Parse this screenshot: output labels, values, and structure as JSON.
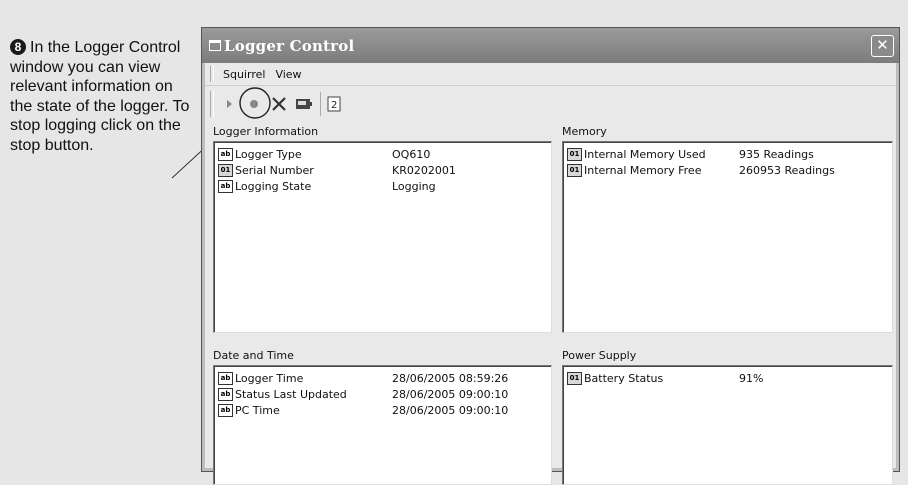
{
  "callout": {
    "step_number": "8",
    "text": "In the Logger Control window you can view relevant information on the state of the logger. To stop logging click on the stop button."
  },
  "window": {
    "title": "Logger Control",
    "close_glyph": "✕",
    "menu": [
      "Squirrel",
      "View"
    ],
    "toolbar": [
      "play-icon",
      "record-icon",
      "stop-x-icon",
      "display-icon",
      "refresh-icon"
    ]
  },
  "panels": {
    "logger_info": {
      "title": "Logger Information",
      "rows": [
        {
          "icon": "text-field-icon",
          "name": "Logger Type",
          "value": "OQ610"
        },
        {
          "icon": "numeric-field-icon",
          "name": "Serial Number",
          "value": "KR0202001"
        },
        {
          "icon": "text-field-icon",
          "name": "Logging State",
          "value": "Logging"
        }
      ]
    },
    "memory": {
      "title": "Memory",
      "rows": [
        {
          "icon": "numeric-field-icon",
          "name": "Internal Memory Used",
          "value": "935 Readings"
        },
        {
          "icon": "numeric-field-icon",
          "name": "Internal Memory Free",
          "value": "260953 Readings"
        }
      ]
    },
    "date_time": {
      "title": "Date and Time",
      "rows": [
        {
          "icon": "text-field-icon",
          "name": "Logger Time",
          "value": "28/06/2005 08:59:26"
        },
        {
          "icon": "text-field-icon",
          "name": "Status Last Updated",
          "value": "28/06/2005 09:00:10"
        },
        {
          "icon": "text-field-icon",
          "name": "PC Time",
          "value": "28/06/2005 09:00:10"
        }
      ]
    },
    "power": {
      "title": "Power Supply",
      "rows": [
        {
          "icon": "numeric-field-icon",
          "name": "Battery Status",
          "value": "91%"
        }
      ]
    }
  }
}
